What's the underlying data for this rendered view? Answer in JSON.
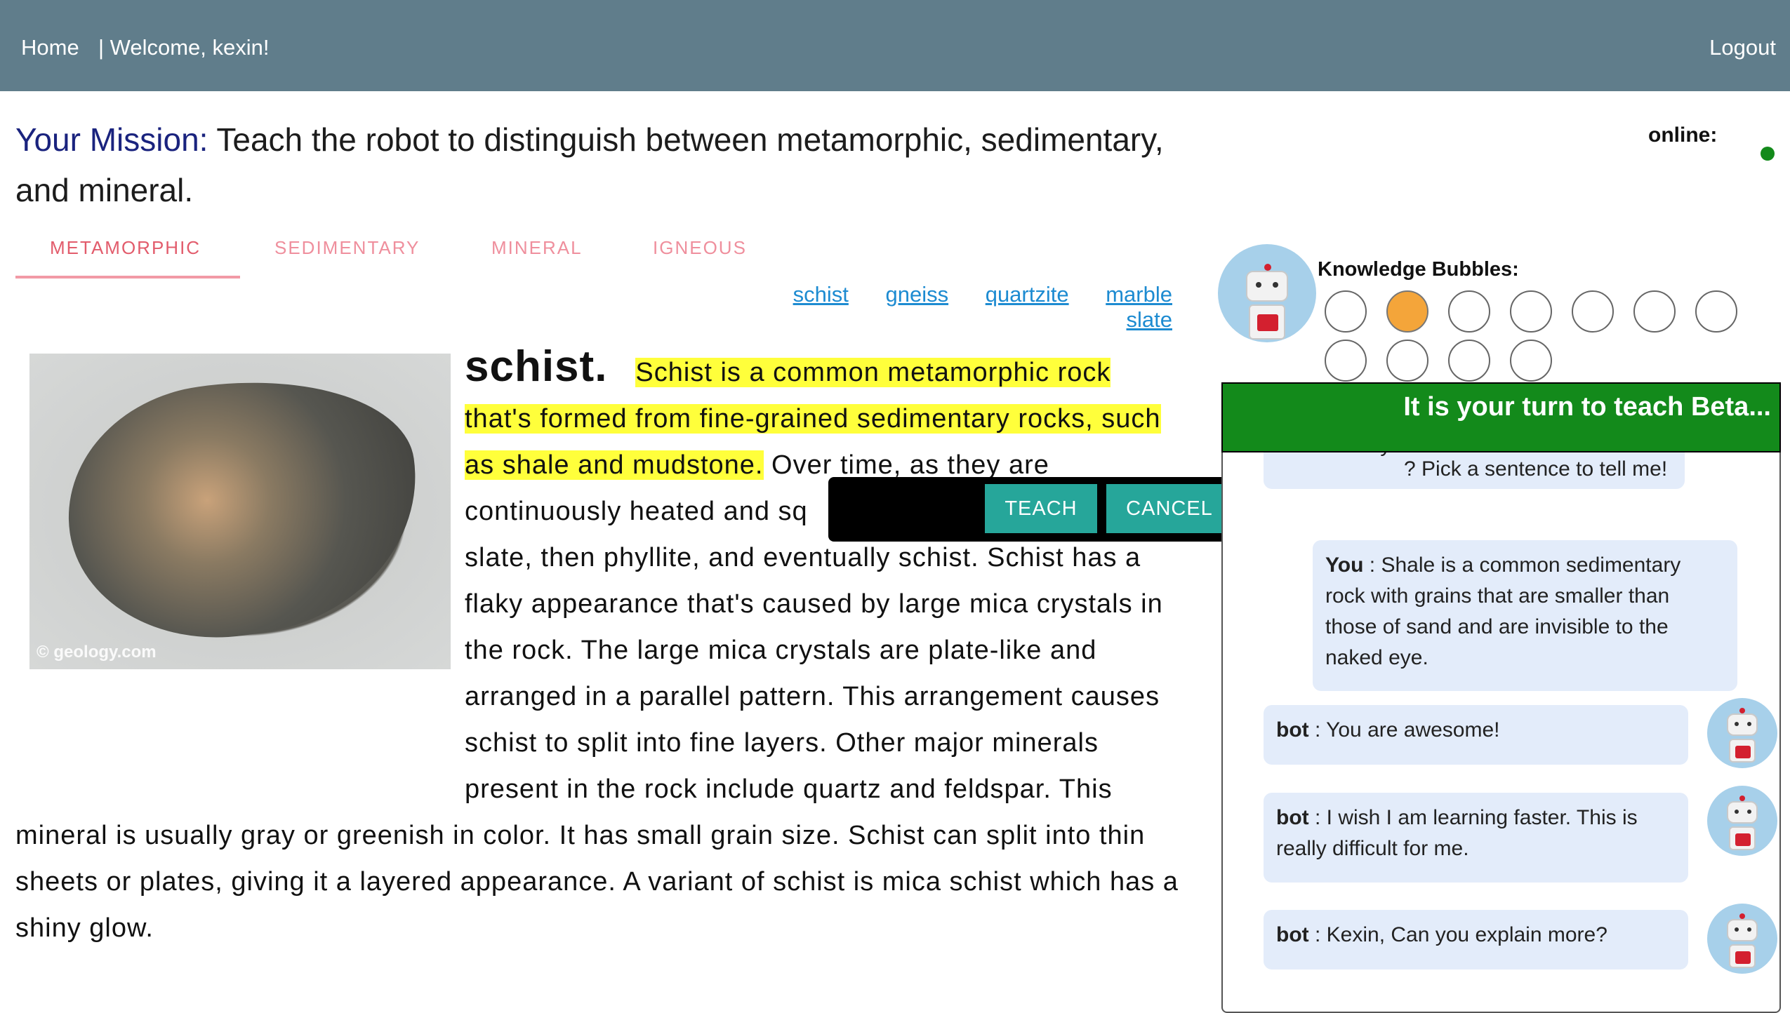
{
  "nav": {
    "home": "Home",
    "welcome": "| Welcome, kexin!",
    "logout": "Logout"
  },
  "mission": {
    "label": "Your Mission:",
    "text": "Teach the robot to distinguish between metamorphic, sedimentary, and mineral."
  },
  "status": {
    "online_label": "online:",
    "online_color": "#138a1b"
  },
  "tabs": [
    {
      "label": "METAMORPHIC",
      "active": true
    },
    {
      "label": "SEDIMENTARY",
      "active": false
    },
    {
      "label": "MINERAL",
      "active": false
    },
    {
      "label": "IGNEOUS",
      "active": false
    }
  ],
  "sublinks": [
    "schist",
    "gneiss",
    "quartzite",
    "marble",
    "slate"
  ],
  "article": {
    "image_caption": "© geology.com",
    "title": "schist.",
    "highlighted": "Schist is a common metamorphic rock that's formed from fine-grained sedimentary rocks, such as shale and mudstone.",
    "rest_visible_1": " Over time, as they are continuously heated and sq",
    "rest_visible_2": "slate, then phyllite, and eventually schist. Schist has a flaky appearance that's caused by large mica crystals in the rock. The large mica crystals are plate-like and arranged in a parallel pattern. This arrangement causes schist to split into fine layers. Other major minerals present in the rock include quartz and feldspar. This mineral is usually gray or greenish in color. It has small grain size. Schist can split into thin sheets or plates, giving it a layered appearance. A variant of schist is mica schist which has a shiny glow."
  },
  "popup": {
    "teach": "TEACH",
    "cancel": "CANCEL"
  },
  "knowledge": {
    "label": "Knowledge Bubbles:",
    "total": 11,
    "filled_index": 1,
    "filled_color": "#f4a53a"
  },
  "banner": {
    "text": "It is your turn to teach Beta...",
    "color": "#138a1b"
  },
  "chat": {
    "partial_top_line1": "sedimentary rocks have sand? What",
    "partial_top_line2": "? Pick a sentence to tell me!",
    "messages": [
      {
        "speaker": "You",
        "text": "Shale is a common sedimentary rock with grains that are smaller than those of sand and are invisible to the naked eye."
      },
      {
        "speaker": "bot",
        "text": "You are awesome!"
      },
      {
        "speaker": "bot",
        "text": "I wish I am learning faster. This is really difficult for me."
      },
      {
        "speaker": "bot",
        "text": "Kexin, Can you explain more?"
      }
    ]
  }
}
